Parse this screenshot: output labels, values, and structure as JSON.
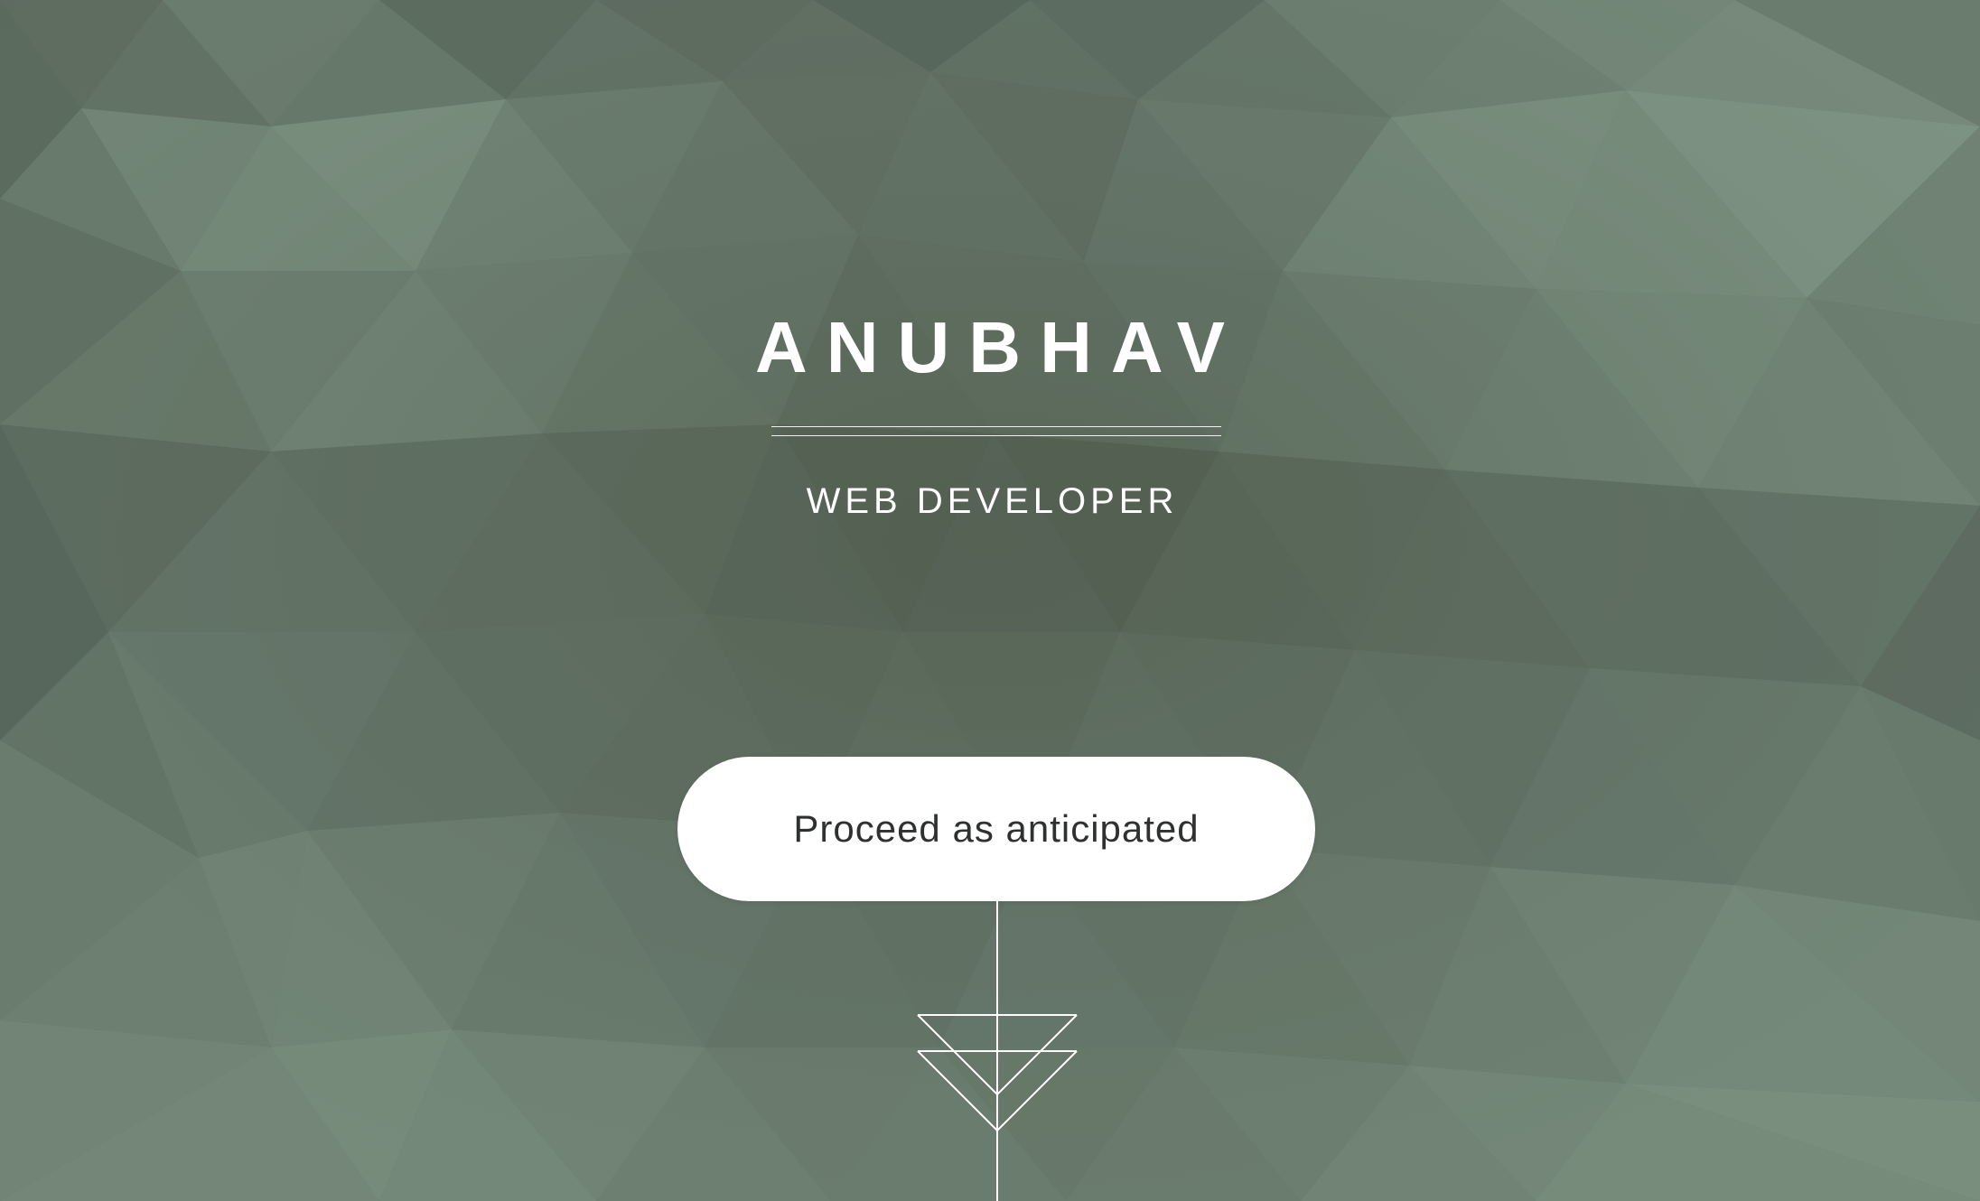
{
  "hero": {
    "name": "ANUBHAV",
    "role": "WEB DEVELOPER",
    "cta_label": "Proceed as anticipated"
  },
  "icons": {
    "scroll_indicator": "down-chevron-arrow-icon"
  },
  "colors": {
    "background_base": "#66776a",
    "text": "#ffffff",
    "button_bg": "#ffffff",
    "button_text": "#2f3131"
  }
}
